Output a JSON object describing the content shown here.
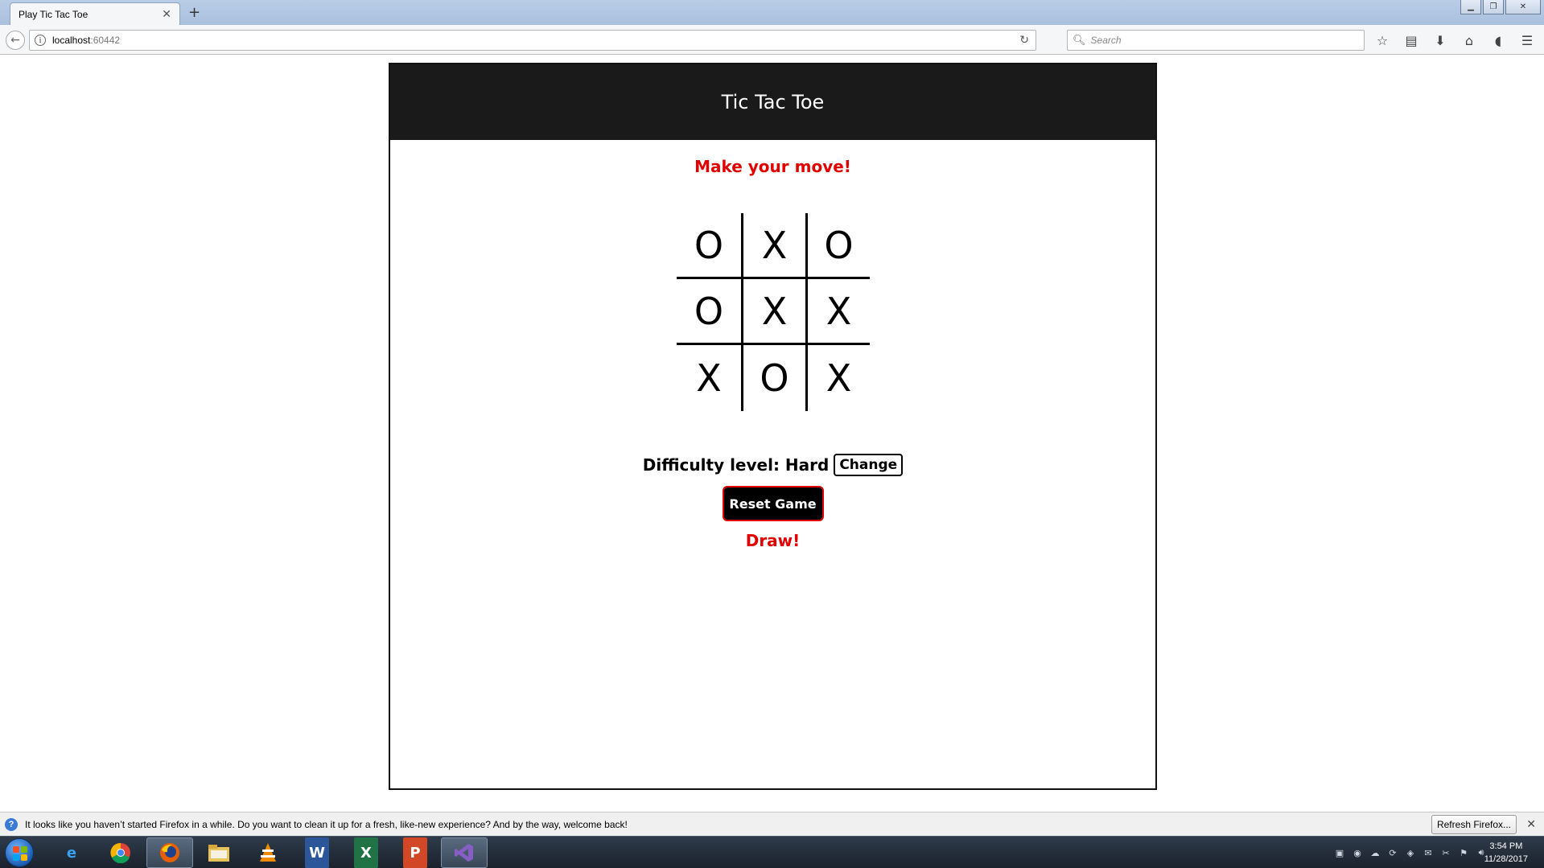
{
  "browser": {
    "tab_title": "Play Tic Tac Toe",
    "url_host": "localhost",
    "url_port": ":60442",
    "search_placeholder": "Search"
  },
  "game": {
    "title": "Tic Tac Toe",
    "status": "Make your move!",
    "board": [
      [
        "O",
        "X",
        "O"
      ],
      [
        "O",
        "X",
        "X"
      ],
      [
        "X",
        "O",
        "X"
      ]
    ],
    "difficulty_label": "Difficulty level: Hard",
    "change_label": "Change",
    "reset_label": "Reset Game",
    "result": "Draw!"
  },
  "notification": {
    "text": "It looks like you haven’t started Firefox in a while. Do you want to clean it up for a fresh, like-new experience? And by the way, welcome back!",
    "button": "Refresh Firefox..."
  },
  "taskbar": {
    "time": "3:54 PM",
    "date": "11/28/2017"
  },
  "colors": {
    "accent_red": "#e10000",
    "header_bg": "#1a1a1a"
  }
}
